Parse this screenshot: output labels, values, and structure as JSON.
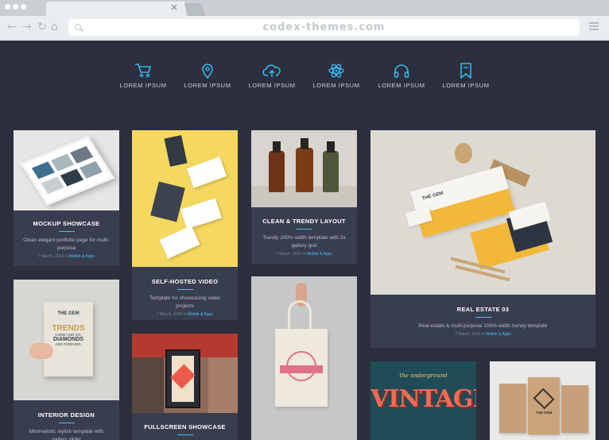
{
  "browser": {
    "url": "codex-themes.com",
    "tab_close": "×",
    "back": "←",
    "forward": "→",
    "reload": "↻",
    "home": "⌂"
  },
  "features": [
    {
      "icon": "cart-icon",
      "label": "LOREM IPSUM"
    },
    {
      "icon": "location-pin-icon",
      "label": "LOREM IPSUM"
    },
    {
      "icon": "cloud-upload-icon",
      "label": "LOREM IPSUM"
    },
    {
      "icon": "atom-icon",
      "label": "LOREM IPSUM"
    },
    {
      "icon": "headphones-icon",
      "label": "LOREM IPSUM"
    },
    {
      "icon": "bookmark-icon",
      "label": "LOREM IPSUM"
    }
  ],
  "cards": {
    "mockup": {
      "title": "MOCKUP SHOWCASE",
      "desc": "Clean elegant portfolio page for multi-purpose",
      "date": "7 March, 2016 in",
      "category": "Mobile & Apps"
    },
    "interior": {
      "title": "INTERIOR DESIGN",
      "desc": "Minimalistic stylish template with gallery slider",
      "book_text": "THE GEM",
      "book_trends": "TRENDS",
      "book_line2": "COME AND GO,",
      "book_line3": "DIAMONDS",
      "book_line4": "ARE FOREVER."
    },
    "selfhosted": {
      "title": "SELF-HOSTED VIDEO",
      "desc": "Template for showcasing video projects",
      "date": "7 March, 2016 in",
      "category": "Mobile & Apps"
    },
    "fullscreen": {
      "title": "FULLSCREEN SHOWCASE"
    },
    "clean": {
      "title": "CLEAN & TRENDY LAYOUT",
      "desc": "Trendy 100% width template with 2x gallery grid",
      "date": "7 March, 2016 in",
      "category": "Mobile & Apps"
    },
    "realestate": {
      "title": "REAL ESTATE 03",
      "desc": "Real estate & multi-purpose 100% width trendy template",
      "date": "7 March, 2016 in",
      "category": "Mobile & Apps",
      "logo": "THE GEM"
    },
    "vintage": {
      "title": "VINTAGE",
      "small": "the underground"
    },
    "bags": {
      "logo": "THE GEM"
    }
  }
}
